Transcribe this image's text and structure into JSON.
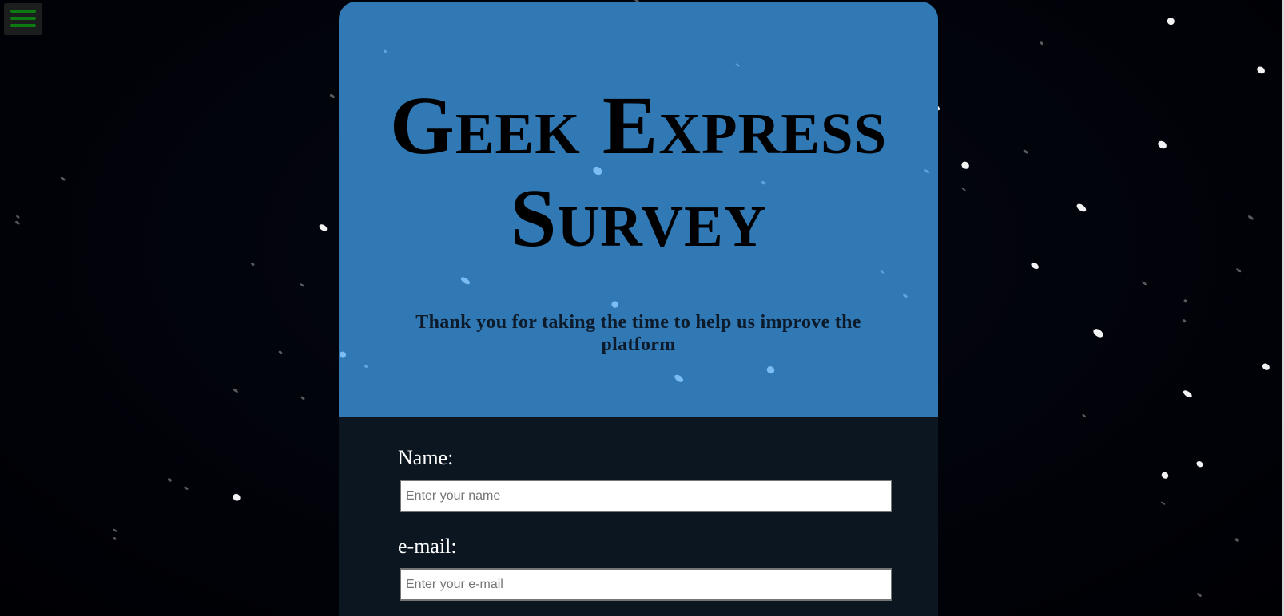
{
  "menu": {
    "icon": "hamburger-menu-icon",
    "color": "#0d7a12"
  },
  "survey": {
    "title": "Geek Express Survey",
    "subtitle": "Thank you for taking the time to help us improve the platform"
  },
  "form": {
    "name_label": "Name:",
    "name_placeholder": "Enter your name",
    "email_label": "e-mail:",
    "email_placeholder": "Enter your e-mail"
  },
  "colors": {
    "page_background": "#02030a",
    "header_background": "#3079b5",
    "form_background": "#0b1620"
  }
}
